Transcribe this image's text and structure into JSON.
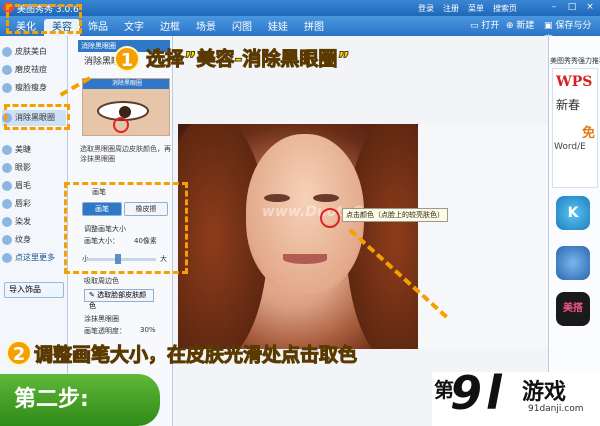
{
  "titlebar": {
    "app_title": "美图秀秀 3.0.6",
    "links": [
      "登录",
      "注册",
      "菜单",
      "搜索页"
    ],
    "controls": [
      "–",
      "□",
      "×"
    ]
  },
  "menubar": {
    "tabs": [
      {
        "label": "美化",
        "active": false
      },
      {
        "label": "美容",
        "active": true
      },
      {
        "label": "饰品",
        "active": false
      },
      {
        "label": "文字",
        "active": false
      },
      {
        "label": "边框",
        "active": false
      },
      {
        "label": "场景",
        "active": false
      },
      {
        "label": "闪图",
        "active": false
      },
      {
        "label": "娃娃",
        "active": false
      },
      {
        "label": "拼图",
        "active": false
      }
    ],
    "open_label": "打开",
    "new_label": "新建",
    "save_label": "保存与分享"
  },
  "sidebar": {
    "items": [
      "皮肤美白",
      "磨皮祛痘",
      "瘦脸瘦身",
      "消除黑眼圈",
      "美睫",
      "眼影",
      "眉毛",
      "唇彩",
      "染发",
      "纹身",
      "点这里更多"
    ],
    "import_label": "导入饰品"
  },
  "panel": {
    "header": "消除黑眼圈",
    "preview_tag": "消除黑眼圈",
    "description": "选取黑眼圈周边皮肤颜色，再涂抹黑眼圈",
    "brush_group_label": "画笔",
    "brush_label": "画笔",
    "eraser_label": "橡皮擦",
    "adjust_label": "调整画笔大小",
    "size_label": "画笔大小：",
    "size_value": "40像素",
    "slider_min": "小",
    "slider_max": "大",
    "slider_fraction": 0.45,
    "color_label": "吸取周边色",
    "pick_label": "选取脸部皮肤颜色",
    "opacity_heading": "涂抹黑眼圈",
    "opacity_label": "画笔透明度：",
    "opacity_value": "30%"
  },
  "canvas": {
    "watermark": "www.DuoteCom",
    "pick_tip": "点击颜色（点脸上的较亮肤色）"
  },
  "ad": {
    "header": "美图秀秀强力推荐",
    "wps": "WPS",
    "script": "新春",
    "free": "免",
    "word": "Word/E",
    "k_icon": "K",
    "meida": "美搭"
  },
  "annotations": {
    "step1_num": "1",
    "step1_text": "选择”美容-消除黑眼圈”",
    "step2_num": "2",
    "step2_text": "调整画笔大小，在皮肤光滑处点击取色",
    "step_badge": "第二步:"
  },
  "brand": {
    "left_fragment": "第",
    "nine": "9",
    "l": "l",
    "name": "游戏",
    "url": "91danji.com"
  },
  "colors": {
    "accent_blue": "#2f77c7",
    "callout_yellow": "#ffe600",
    "dash_orange": "#f5a000",
    "step_green": "#3f9a22",
    "pick_red": "#e32222"
  }
}
